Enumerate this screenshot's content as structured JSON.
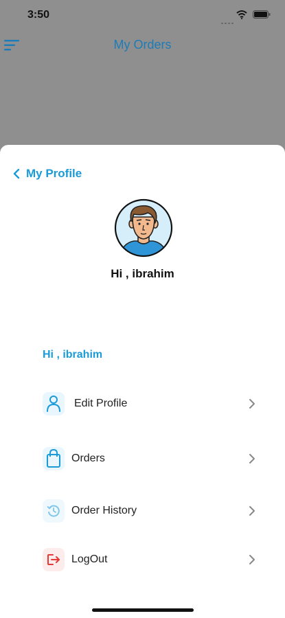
{
  "status_bar": {
    "time": "3:50"
  },
  "header": {
    "title": "My Orders",
    "menu_icon": "hamburger-menu-icon"
  },
  "sheet": {
    "back_label": "My Profile",
    "greeting": "Hi , ibrahim",
    "greeting_secondary": "Hi , ibrahim",
    "menu_items": [
      {
        "label": "Edit Profile",
        "icon": "user-icon"
      },
      {
        "label": "Orders",
        "icon": "shopping-bag-icon"
      },
      {
        "label": "Order History",
        "icon": "history-icon"
      },
      {
        "label": "LogOut",
        "icon": "logout-icon"
      }
    ]
  },
  "colors": {
    "accent": "#1a9bd7",
    "logout": "#e53935",
    "overlay": "#8f8f8f"
  }
}
